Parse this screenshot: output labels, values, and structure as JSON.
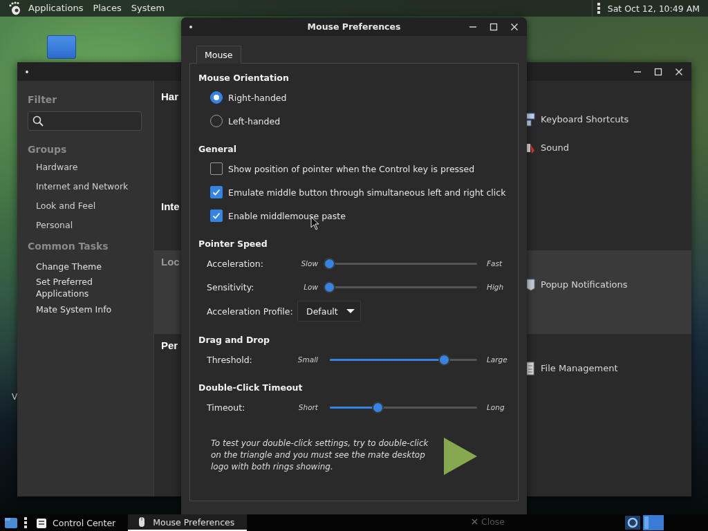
{
  "top_panel": {
    "menus": [
      "Applications",
      "Places",
      "System"
    ],
    "clock": "Sat Oct 12, 10:49 AM"
  },
  "desktop": {
    "label": "V"
  },
  "control_center": {
    "sidebar": {
      "filter_heading": "Filter",
      "groups_heading": "Groups",
      "groups": [
        "Hardware",
        "Internet and Network",
        "Look and Feel",
        "Personal"
      ],
      "tasks_heading": "Common Tasks",
      "tasks": [
        "Change Theme",
        "Set Preferred Applications",
        "Mate System Info"
      ]
    },
    "categories": [
      {
        "heading": "Har",
        "selected": false,
        "items": [
          {
            "kind": "keyboard",
            "label": "Keyboard Shortcuts"
          },
          {
            "kind": "sound",
            "label": "Sound"
          }
        ]
      },
      {
        "heading": "Inte",
        "selected": false
      },
      {
        "heading": "Loc",
        "selected": true,
        "items": [
          {
            "kind": "notification",
            "label": "Popup Notifications"
          }
        ]
      },
      {
        "heading": "Per",
        "selected": false,
        "items": [
          {
            "kind": "files",
            "label": "File Management"
          }
        ]
      }
    ]
  },
  "mouse_window": {
    "title": "Mouse Preferences",
    "tabs": [
      {
        "label": "Mouse",
        "selected": true
      }
    ],
    "sections": [
      {
        "heading": "Mouse Orientation",
        "rows": [
          {
            "kind": "radio",
            "label": "Right-handed",
            "selected": true
          },
          {
            "kind": "radio",
            "label": "Left-handed",
            "selected": false
          }
        ]
      },
      {
        "heading": "General",
        "rows": [
          {
            "kind": "checkbox",
            "label": "Show position of pointer when the Control key is pressed",
            "checked": false
          },
          {
            "kind": "checkbox",
            "label": "Emulate middle button through simultaneous left and right click",
            "checked": true
          },
          {
            "kind": "checkbox",
            "label": "Enable middlemouse paste",
            "checked": true
          }
        ]
      },
      {
        "heading": "Pointer Speed",
        "rows": [
          {
            "kind": "slider",
            "label": "Acceleration:",
            "min_label": "Slow",
            "max_label": "Fast",
            "level": 0
          },
          {
            "kind": "slider",
            "label": "Sensitivity:",
            "min_label": "Low",
            "max_label": "High",
            "level": 0
          },
          {
            "kind": "dropdown",
            "label": "Acceleration Profile:",
            "value": "Default"
          }
        ]
      },
      {
        "heading": "Drag and Drop",
        "rows": [
          {
            "kind": "slider",
            "label": "Threshold:",
            "min_label": "Small",
            "max_label": "Large",
            "level": 0.78
          }
        ]
      },
      {
        "heading": "Double-Click Timeout",
        "rows": [
          {
            "kind": "slider",
            "label": "Timeout:",
            "min_label": "Short",
            "max_label": "Long",
            "level": 0.33
          },
          {
            "kind": "note",
            "text": "To test your double-click settings, try to double-click on the triangle and you must see the mate desktop logo with both rings showing."
          }
        ]
      }
    ],
    "close_button": "Close"
  },
  "taskbar": {
    "tasks": [
      {
        "kind": "control-center",
        "label": "Control Center",
        "selected": false
      },
      {
        "kind": "mouse",
        "label": "Mouse Preferences",
        "selected": true
      }
    ]
  }
}
